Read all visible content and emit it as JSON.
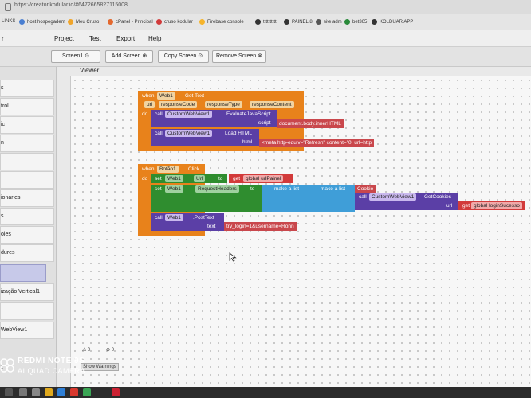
{
  "browser": {
    "url": "https://creator.kodular.io/#6472665827115008",
    "bookmarks": [
      "LINKS",
      "host hospegadem",
      "Meu Cruso",
      "cPanel - Principal",
      "cruso kodular",
      "Firebase console",
      "tttttttttt",
      "PAINEL 8",
      "site adm",
      "bet365",
      "KOLDUAR APP"
    ]
  },
  "menu": {
    "logo": "r",
    "items": [
      "Project",
      "Test",
      "Export",
      "Help"
    ]
  },
  "toolbar": {
    "screen": "Screen1 ⊙",
    "add": "Add Screen ⊕",
    "copy": "Copy Screen ⊙",
    "remove": "Remove Screen ⊗"
  },
  "sidebar": {
    "items": [
      "s",
      "trol",
      "ic",
      "n",
      "",
      "",
      "ionaries",
      "s",
      "oles",
      "dures",
      "",
      "ização Vertical1",
      "",
      "WebView1",
      "1"
    ]
  },
  "viewer": {
    "label": "Viewer"
  },
  "blocks": {
    "ev1": {
      "when": "when",
      "component": "Web1",
      "event": "Got Text",
      "params": [
        "url",
        "responseCode",
        "responseType",
        "responseContent"
      ],
      "do": "do"
    },
    "call1": {
      "call": "call",
      "component": "CustomWebView1",
      "method": "EvaluateJavaScript",
      "arg": "script",
      "value": "document.body.innerHTML"
    },
    "call2": {
      "call": "call",
      "component": "CustomWebView1",
      "method": "Load HTML",
      "arg": "html",
      "value": "<meta http-equiv=\"Refresh\" content=\"0; url=http"
    },
    "ev2": {
      "when": "when",
      "component": "Botão1",
      "event": "Click",
      "do": "do"
    },
    "set1": {
      "set": "set",
      "component": "Web1",
      "prop": "Url",
      "to": "to",
      "get": "get",
      "var": "global urlPainel"
    },
    "set2": {
      "set": "set",
      "component": "Web1",
      "prop": "RequestHeaders",
      "to": "to",
      "list1": "make a list",
      "list2": "make a list",
      "cookie": "Cookie"
    },
    "call3": {
      "call": "call",
      "component": "CustomWebView1",
      "method": "GetCookies",
      "arg": "url",
      "get": "get",
      "var": "global loginSucesso"
    },
    "call4": {
      "call": "call",
      "component": "Web1",
      "method": ".PostText",
      "arg": "text",
      "value": "try_login=1&username=Ronn"
    }
  },
  "warnings": {
    "warn": "0",
    "err": "0",
    "label": "Show Warnings"
  },
  "watermark": {
    "line1": "REDMI NOTE 9S",
    "line2": "AI QUAD CAMERA"
  },
  "colors": {
    "event": "#e8821b",
    "call": "#5b3fa6",
    "set": "#2f8d2f",
    "list": "#3f9ed8",
    "text": "#c9474c"
  }
}
